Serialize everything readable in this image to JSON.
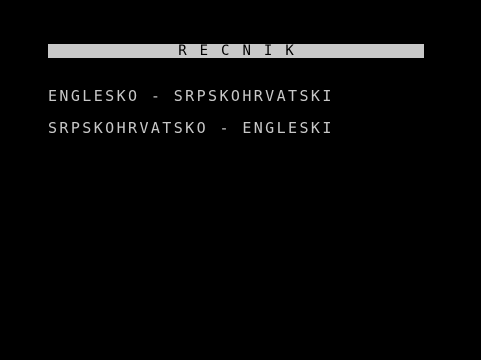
{
  "title": "RECNIK",
  "menu": {
    "items": [
      {
        "label": "ENGLESKO - SRPSKOHRVATSKI"
      },
      {
        "label": "SRPSKOHRVATSKO - ENGLESKI"
      }
    ]
  },
  "colors": {
    "background": "#000000",
    "text": "#c8c8c8",
    "title_bar": "#c8c8c8",
    "title_text": "#000000"
  }
}
